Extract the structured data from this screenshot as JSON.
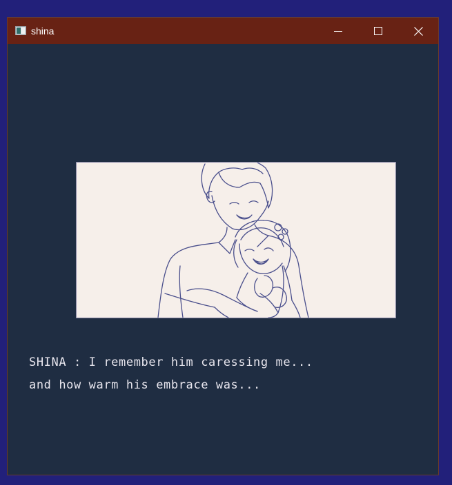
{
  "window": {
    "title": "shina",
    "colors": {
      "desktop": "#22207a",
      "titlebar": "#682214",
      "game_bg": "#1f2d42",
      "scene_bg": "#f6efea",
      "line_art": "#4a4f8c",
      "text": "#e8e6ee"
    },
    "controls": [
      "minimize-icon",
      "maximize-icon",
      "close-icon"
    ]
  },
  "scene": {
    "description_icon": "cg-illustration-embrace"
  },
  "dialogue": {
    "line1": "SHINA : I remember him caressing me...",
    "line2": "and how warm his embrace was..."
  }
}
